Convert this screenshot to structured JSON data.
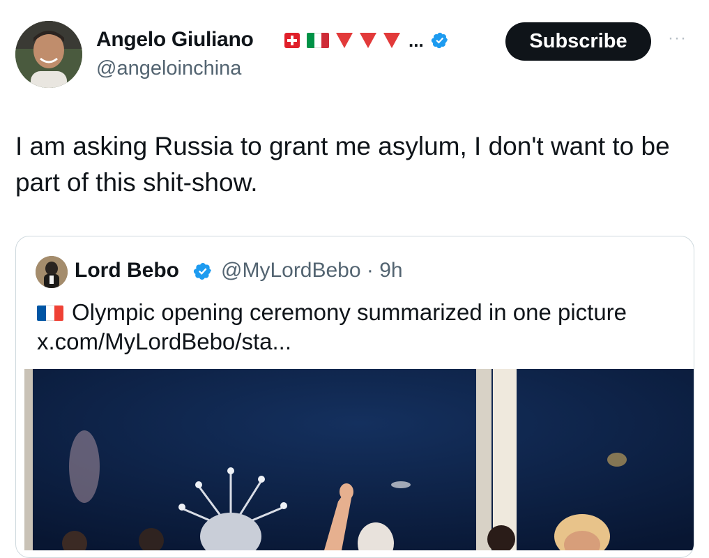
{
  "author": {
    "name": "Angelo Giuliano",
    "handle": "@angeloinchina",
    "flags": [
      "swiss-flag-icon",
      "italy-flag-icon",
      "red-triangle-icon",
      "red-triangle-icon",
      "red-triangle-icon"
    ],
    "ellipsis": "...",
    "verified": true
  },
  "actions": {
    "subscribe_label": "Subscribe",
    "more_label": "···"
  },
  "tweet": {
    "text": "I am asking Russia to grant me asylum, I don't want to be part of this shit-show."
  },
  "quote": {
    "name": "Lord Bebo",
    "handle_time": "@MyLordBebo · 9h",
    "text": "Olympic opening ceremony summarized in one picture",
    "link": "x.com/MyLordBebo/sta...",
    "flag": "france-flag-icon"
  },
  "colors": {
    "verified": "#1d9bf0",
    "subscribe_bg": "#0f1419",
    "triangle": "#e23a3a",
    "secondary_text": "#536471"
  }
}
